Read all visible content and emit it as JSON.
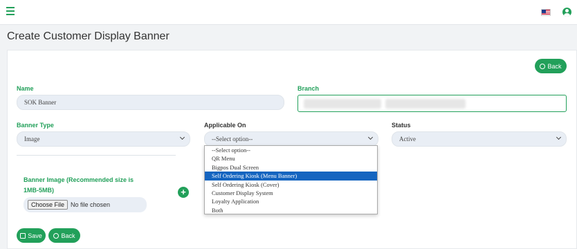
{
  "page": {
    "title": "Create Customer Display Banner"
  },
  "header": {
    "menu_icon": "hamburger-icon",
    "flag_icon": "us-flag-icon",
    "user_icon": "user-circle-icon"
  },
  "colors": {
    "accent": "#22a05a",
    "selected_option": "#1565c0",
    "field_bg": "#e9eef5"
  },
  "form": {
    "back_top_label": "Back",
    "name_label": "Name",
    "name_value": "SOK Banner",
    "branch_label": "Branch",
    "banner_type_label": "Banner Type",
    "banner_type_value": "Image",
    "applicable_on_label": "Applicable On",
    "applicable_on_value": "--Select option--",
    "status_label": "Status",
    "status_value": "Active",
    "banner_image_label": "Banner Image (Recommended size is",
    "banner_image_label_2": "1MB-5MB)",
    "choose_file_label": "Choose File",
    "no_file_label": "No file chosen",
    "save_label": "Save",
    "back_bottom_label": "Back"
  },
  "dropdown": {
    "options": [
      "--Select option--",
      "QR Menu",
      "Bigpos Dual Screen",
      "Self Ordering Kiosk (Menu Banner)",
      "Self Ordering Kiosk (Cover)",
      "Customer Display System",
      "Loyalty Application",
      "Both"
    ],
    "selected_index": 3
  }
}
